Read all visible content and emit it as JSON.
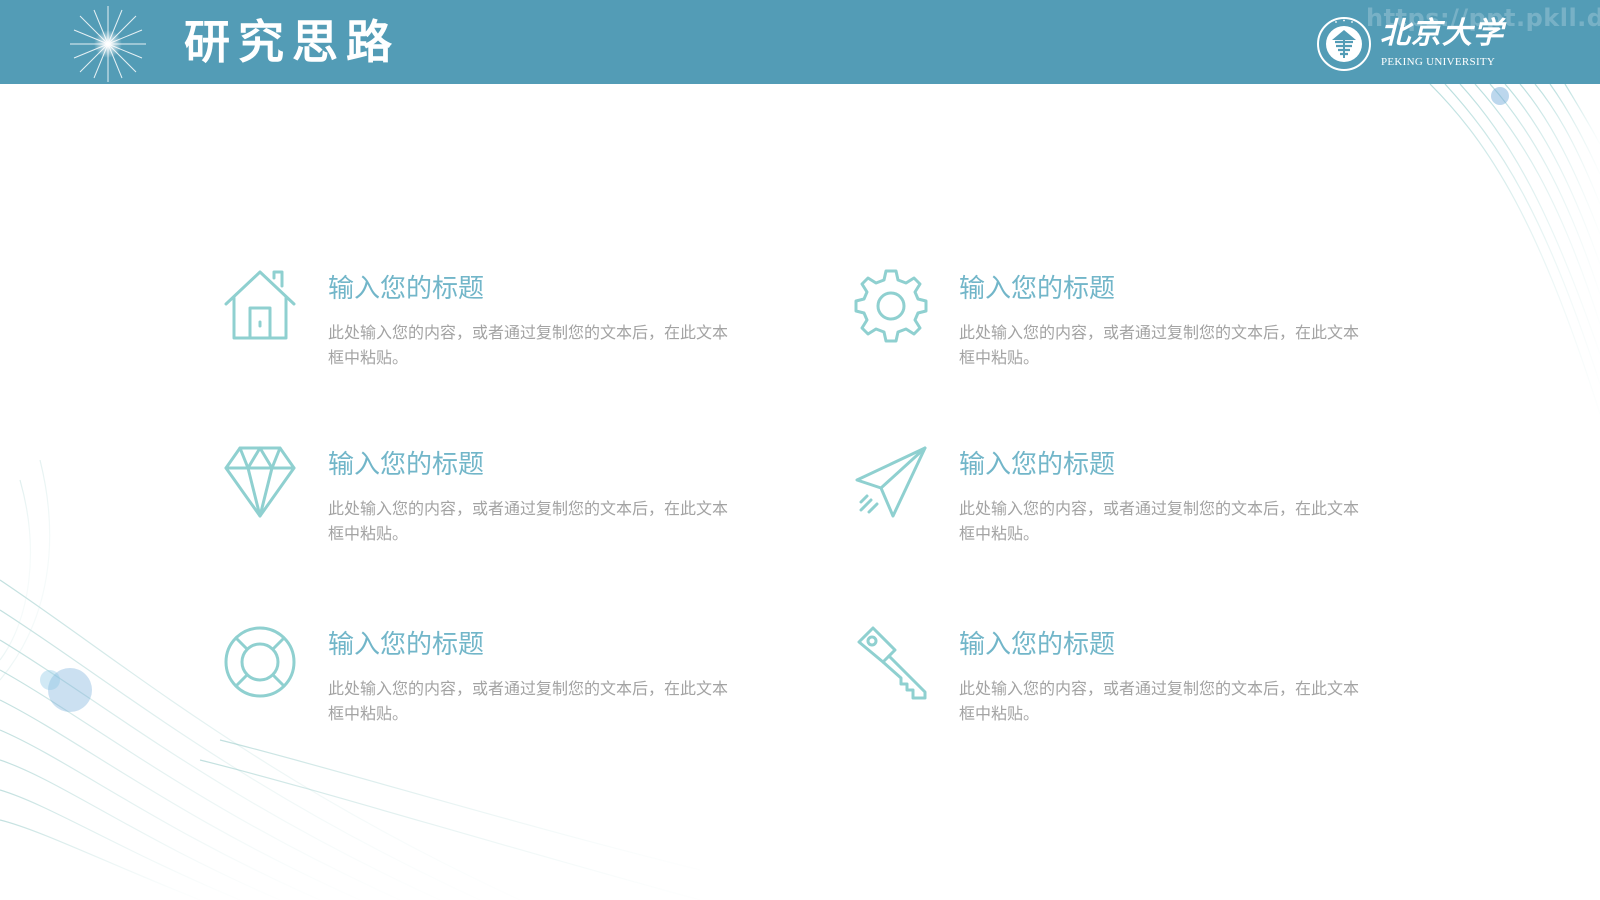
{
  "header": {
    "title": "研究思路",
    "watermark": "https://ppt.pkll.de",
    "logo": {
      "cn_text": "北京大学",
      "en_text": "PEKING UNIVERSITY",
      "emblem_text": "PEKING UNIVERSITY 1898"
    }
  },
  "items": [
    {
      "icon": "house-icon",
      "heading": "输入您的标题",
      "desc": "此处输入您的内容，或者通过复制您的文本后，在此文本框中粘贴。"
    },
    {
      "icon": "gear-icon",
      "heading": "输入您的标题",
      "desc": "此处输入您的内容，或者通过复制您的文本后，在此文本框中粘贴。"
    },
    {
      "icon": "diamond-icon",
      "heading": "输入您的标题",
      "desc": "此处输入您的内容，或者通过复制您的文本后，在此文本框中粘贴。"
    },
    {
      "icon": "paper-plane-icon",
      "heading": "输入您的标题",
      "desc": "此处输入您的内容，或者通过复制您的文本后，在此文本框中粘贴。"
    },
    {
      "icon": "lifebuoy-icon",
      "heading": "输入您的标题",
      "desc": "此处输入您的内容，或者通过复制您的文本后，在此文本框中粘贴。"
    },
    {
      "icon": "key-icon",
      "heading": "输入您的标题",
      "desc": "此处输入您的内容，或者通过复制您的文本后，在此文本框中粘贴。"
    }
  ],
  "colors": {
    "header_bg": "#539cb6",
    "heading": "#72b6c9",
    "body_text": "#a3a3a3",
    "icon_stroke": "#8fd0d0"
  }
}
